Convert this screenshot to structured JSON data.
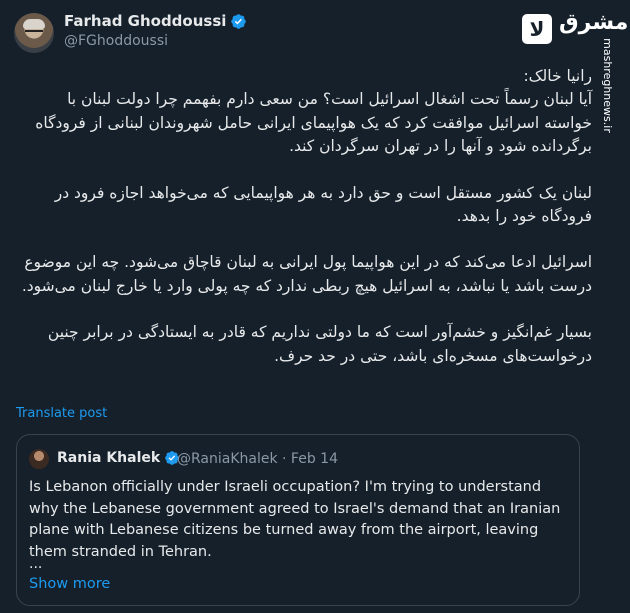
{
  "author": {
    "name": "Farhad Ghoddoussi",
    "handle": "@FGhoddoussi"
  },
  "brand": {
    "logo_letter": "لا",
    "logo_word": "مشرق",
    "watermark": "mashreghnews.ir"
  },
  "post": {
    "greeting": "رانیا خالک:",
    "paragraphs": [
      "آیا لبنان رسماً تحت اشغال اسرائیل است؟ من سعی دارم بفهمم چرا دولت لبنان با خواسته اسرائیل موافقت کرد که یک هواپیمای ایرانی حامل شهروندان لبنانی از فرودگاه برگردانده شود و آنها را در تهران سرگردان کند.",
      "لبنان یک کشور مستقل است و حق دارد به هر هواپیمایی که می‌خواهد اجازه فرود در فرودگاه خود را بدهد.",
      "اسرائیل ادعا می‌کند که در این هواپیما پول ایرانی به لبنان قاچاق می‌شود. چه این موضوع درست باشد یا نباشد، به اسرائیل هیچ ربطی ندارد که چه پولی وارد یا خارج لبنان می‌شود.",
      "بسیار غم‌انگیز و خشم‌آور است که ما دولتی نداریم که قادر به ایستادگی در برابر چنین درخواست‌های مسخره‌ای باشد، حتی در حد حرف."
    ],
    "translate_label": "Translate post"
  },
  "quote": {
    "name": "Rania Khalek",
    "meta": "@RaniaKhalek · Feb 14",
    "text": "Is Lebanon officially under Israeli occupation? I'm trying to understand why the Lebanese government agreed to Israel's demand that an Iranian plane with Lebanese citizens be turned away from the airport, leaving them stranded in Tehran.",
    "ellipsis": "...",
    "show_more": "Show more"
  },
  "colors": {
    "background": "#15202b",
    "accent": "#1d9bf0",
    "verified": "#1d9bf0"
  }
}
